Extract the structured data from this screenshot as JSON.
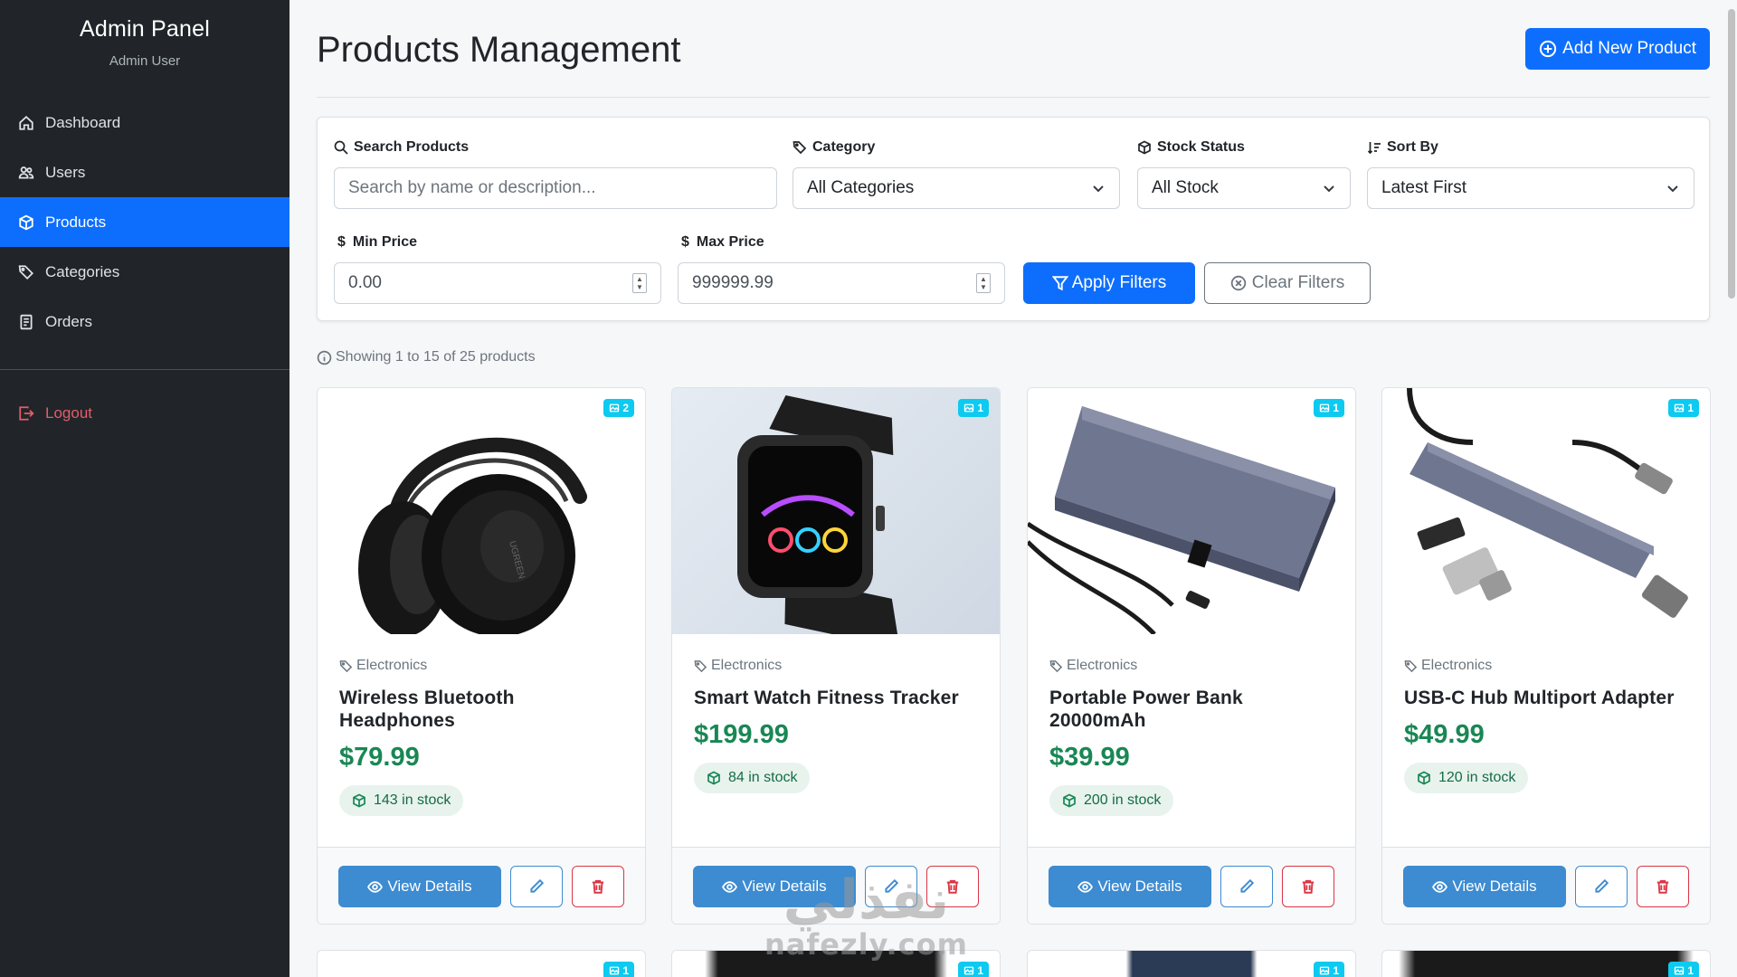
{
  "sidebar": {
    "title": "Admin Panel",
    "subtitle": "Admin User",
    "items": [
      {
        "label": "Dashboard",
        "icon": "house-icon"
      },
      {
        "label": "Users",
        "icon": "people-icon"
      },
      {
        "label": "Products",
        "icon": "box-icon",
        "active": true
      },
      {
        "label": "Categories",
        "icon": "tags-icon"
      },
      {
        "label": "Orders",
        "icon": "receipt-icon"
      }
    ],
    "logout": "Logout"
  },
  "header": {
    "title": "Products Management",
    "add_button": "Add New Product"
  },
  "filters": {
    "search": {
      "label": "Search Products",
      "placeholder": "Search by name or description..."
    },
    "category": {
      "label": "Category",
      "value": "All Categories"
    },
    "stock": {
      "label": "Stock Status",
      "value": "All Stock"
    },
    "sort": {
      "label": "Sort By",
      "value": "Latest First"
    },
    "min_price": {
      "label": "Min Price",
      "value": "0.00",
      "symbol": "$"
    },
    "max_price": {
      "label": "Max Price",
      "value": "999999.99",
      "symbol": "$"
    },
    "apply": "Apply Filters",
    "clear": "Clear Filters"
  },
  "results_info": "Showing 1 to 15 of 25 products",
  "products": [
    {
      "name": "Wireless Bluetooth Headphones",
      "category": "Electronics",
      "price": "$79.99",
      "stock": "143 in stock",
      "images": "2",
      "view": "View Details"
    },
    {
      "name": "Smart Watch Fitness Tracker",
      "category": "Electronics",
      "price": "$199.99",
      "stock": "84 in stock",
      "images": "1",
      "view": "View Details"
    },
    {
      "name": "Portable Power Bank 20000mAh",
      "category": "Electronics",
      "price": "$39.99",
      "stock": "200 in stock",
      "images": "1",
      "view": "View Details"
    },
    {
      "name": "USB-C Hub Multiport Adapter",
      "category": "Electronics",
      "price": "$49.99",
      "stock": "120 in stock",
      "images": "1",
      "view": "View Details"
    }
  ],
  "next_row_badges": [
    "1",
    "1",
    "1",
    "1"
  ],
  "watermark": {
    "arabic": "نفذلي",
    "latin": "nafezly.com"
  },
  "colors": {
    "primary": "#0d6efd",
    "sidebar": "#212529",
    "price": "#198754",
    "danger": "#dc3545",
    "info_badge": "#0dcaf0"
  }
}
